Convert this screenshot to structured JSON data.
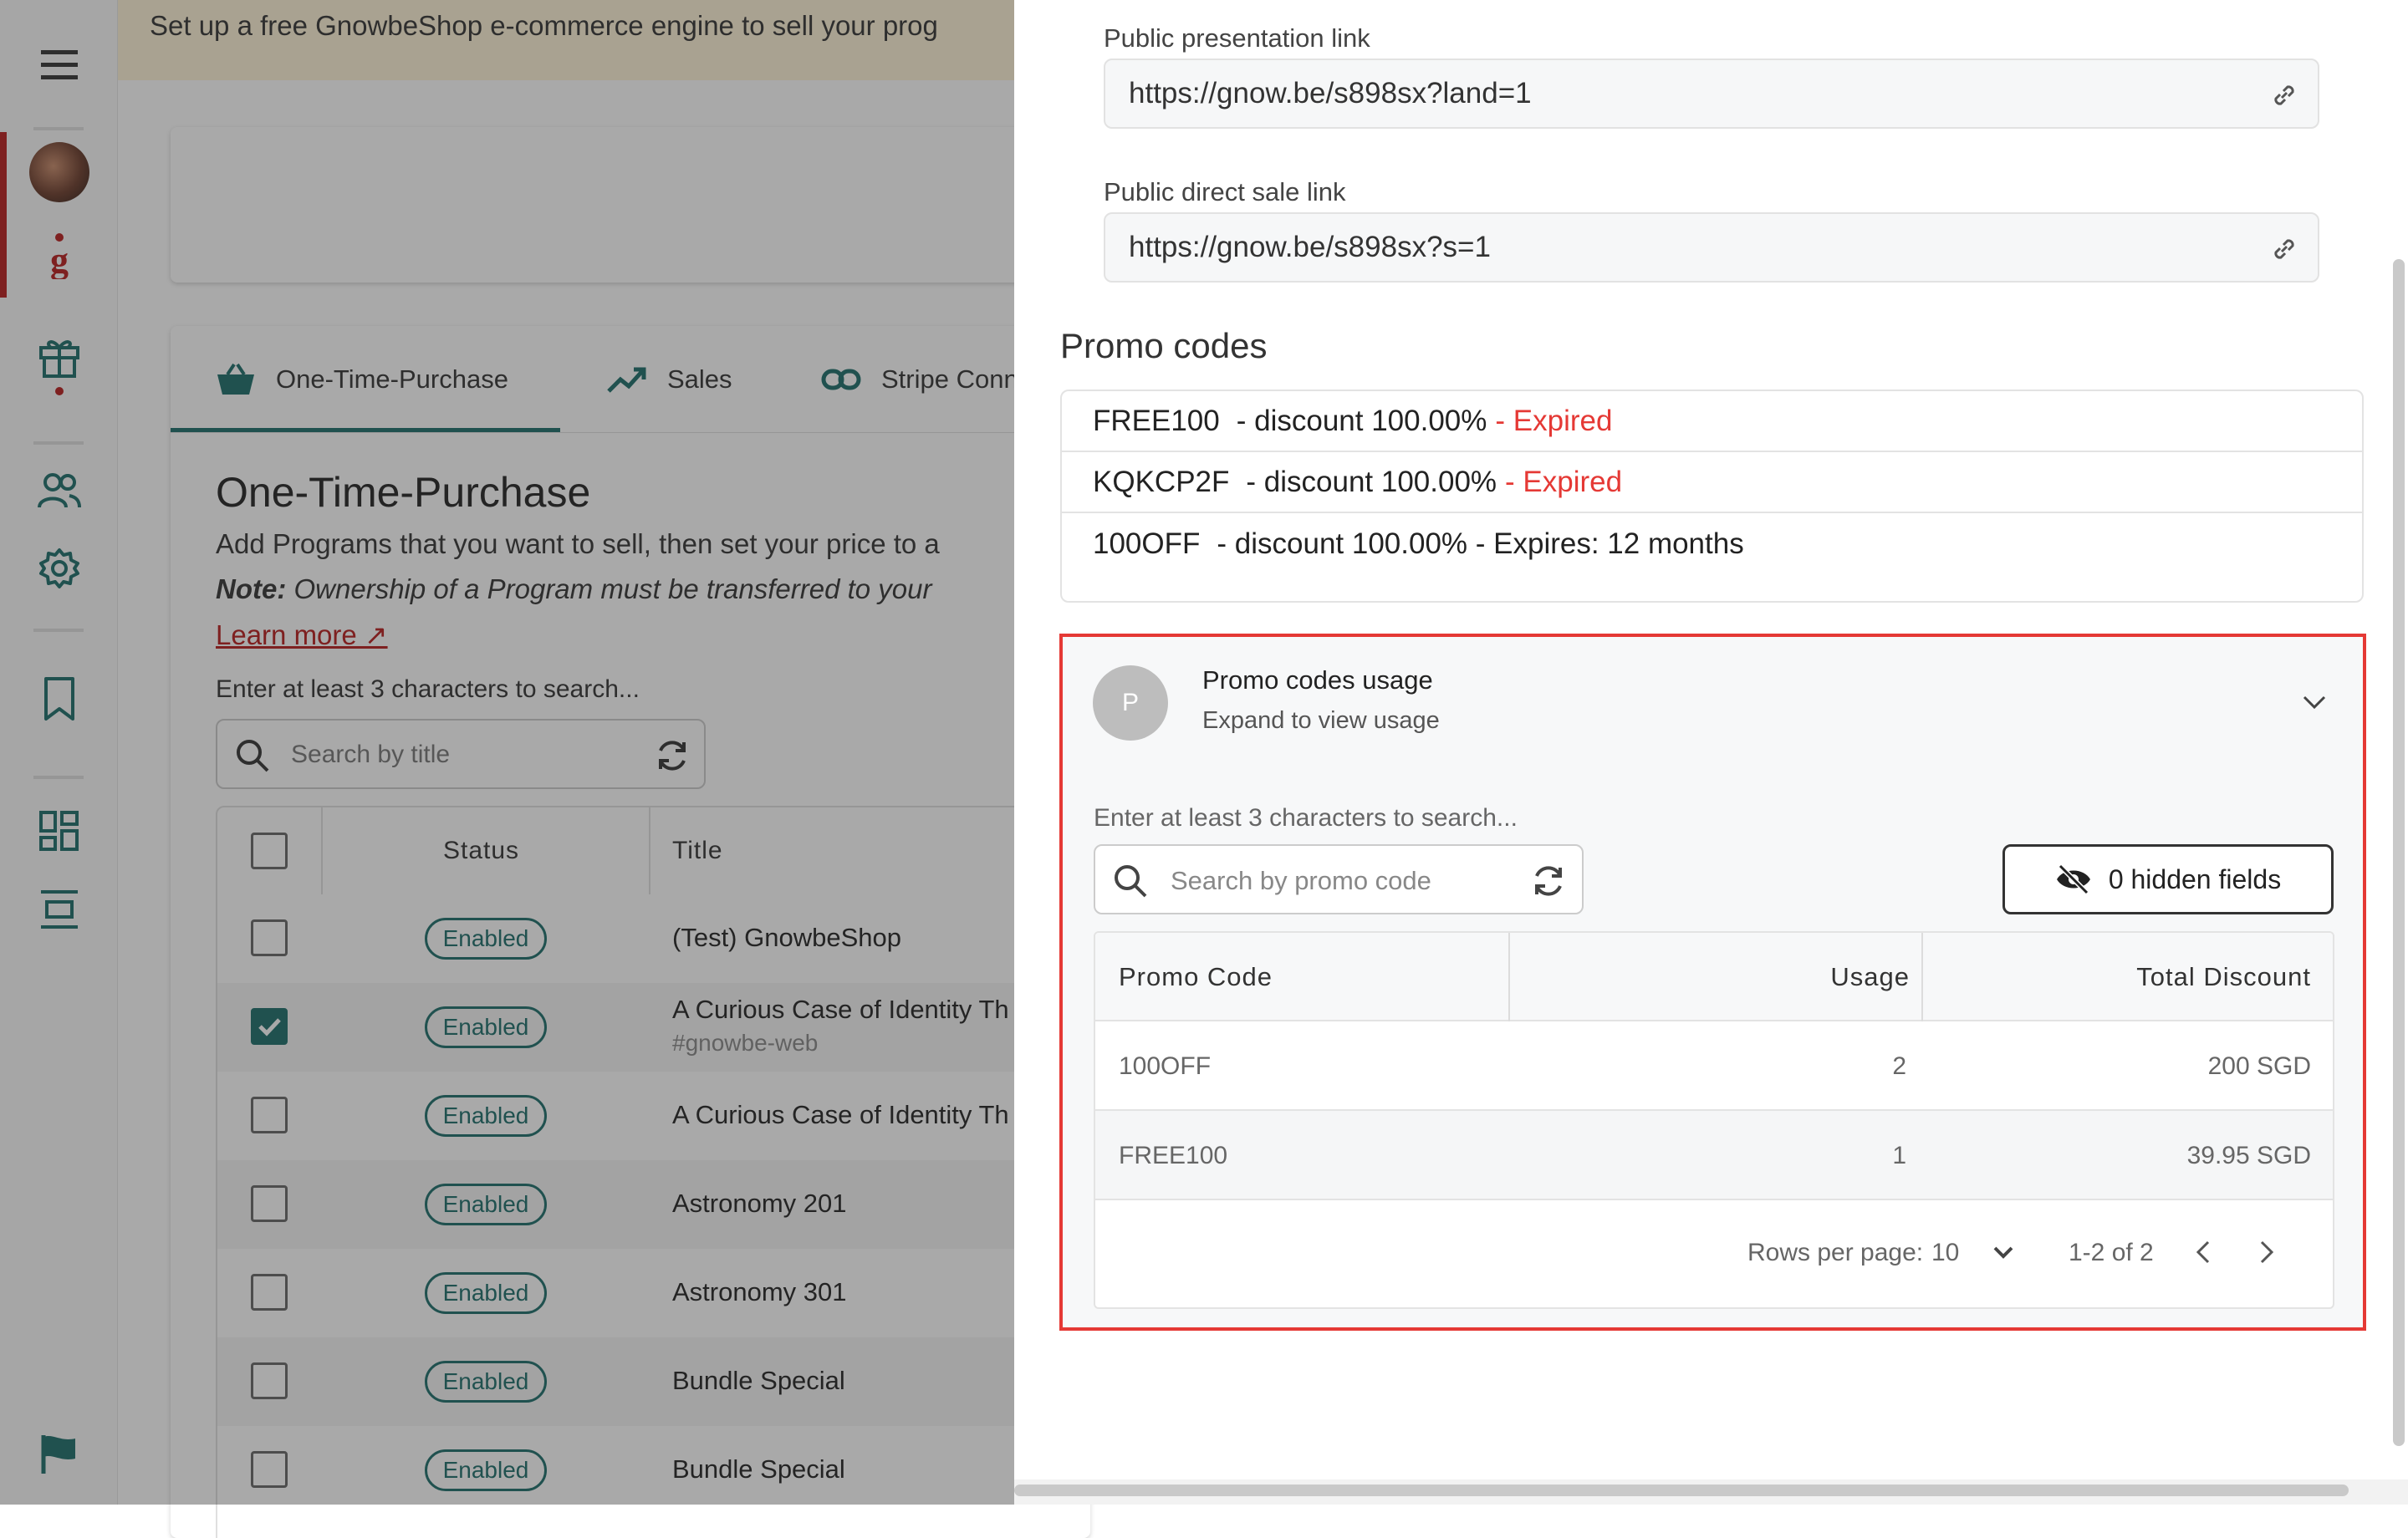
{
  "banner": {
    "text": "Set up a free GnowbeShop e-commerce engine to sell your prog"
  },
  "rail": {
    "icons": [
      "menu-icon",
      "avatar",
      "gnowbe-logo-icon",
      "gift-icon",
      "users-icon",
      "settings-icon",
      "bookmark-icon",
      "dashboard-icon",
      "layout-icon",
      "flag-icon"
    ]
  },
  "main": {
    "tabs": [
      {
        "label": "One-Time-Purchase",
        "icon": "basket-icon"
      },
      {
        "label": "Sales",
        "icon": "trending-up-icon"
      },
      {
        "label": "Stripe Conn",
        "icon": "link-icon"
      }
    ],
    "title": "One-Time-Purchase",
    "desc": "Add Programs that you want to sell, then set your price to a",
    "note_bold": "Note:",
    "note_rest": " Ownership of a Program must be transferred to your",
    "learn_more": "Learn more ↗",
    "search_hint": "Enter at least 3 characters to search...",
    "search_placeholder": "Search by title",
    "columns": {
      "status": "Status",
      "title": "Title"
    },
    "rows": [
      {
        "status": "Enabled",
        "title": "(Test) GnowbeShop",
        "sub": "",
        "checked": false
      },
      {
        "status": "Enabled",
        "title": "A Curious Case of Identity Th",
        "sub": "#gnowbe-web",
        "checked": true
      },
      {
        "status": "Enabled",
        "title": "A Curious Case of Identity Th",
        "sub": "",
        "checked": false
      },
      {
        "status": "Enabled",
        "title": "Astronomy 201",
        "sub": "",
        "checked": false
      },
      {
        "status": "Enabled",
        "title": "Astronomy 301",
        "sub": "",
        "checked": false
      },
      {
        "status": "Enabled",
        "title": "Bundle Special",
        "sub": "",
        "checked": false
      },
      {
        "status": "Enabled",
        "title": "Bundle Special",
        "sub": "",
        "checked": false
      }
    ]
  },
  "panel": {
    "presentation_label": "Public presentation link",
    "presentation_url": "https://gnow.be/s898sx?land=1",
    "direct_label": "Public direct sale link",
    "direct_url": "https://gnow.be/s898sx?s=1",
    "promo_title": "Promo codes",
    "promo_codes": [
      {
        "code": "FREE100",
        "text": "- discount  100.00%",
        "expiry": "- Expired"
      },
      {
        "code": "KQKCP2F",
        "text": "- discount  100.00%",
        "expiry": "- Expired"
      },
      {
        "code": "100OFF",
        "text": "- discount  100.00% - Expires: 12 months",
        "expiry": ""
      }
    ],
    "usage": {
      "avatar_letter": "P",
      "title": "Promo codes usage",
      "subtitle": "Expand to view usage",
      "search_hint": "Enter at least 3 characters to search...",
      "search_placeholder": "Search by promo code",
      "hidden_fields": "0 hidden fields",
      "columns": [
        "Promo Code",
        "Usage",
        "Total Discount"
      ],
      "rows": [
        {
          "code": "100OFF",
          "usage": "2",
          "total": "200 SGD"
        },
        {
          "code": "FREE100",
          "usage": "1",
          "total": "39.95 SGD"
        }
      ],
      "rows_per_page_label": "Rows per page:",
      "rows_per_page": "10",
      "range": "1-2 of 2"
    }
  },
  "colors": {
    "accent": "#1b6d6a",
    "expired": "#e53935",
    "highlight": "#e53935",
    "brand": "#b71c1c"
  }
}
